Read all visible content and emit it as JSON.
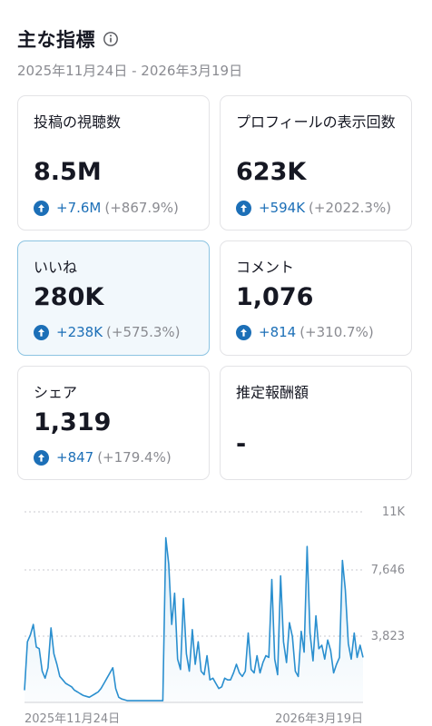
{
  "header": {
    "title": "主な指標",
    "date_range": "2025年11月24日 - 2026年3月19日"
  },
  "cards": [
    {
      "label": "投稿の視聴数",
      "value": "8.5M",
      "delta": "+7.6M",
      "pct": "(+867.9%)",
      "selected": false
    },
    {
      "label": "プロフィールの表示回数",
      "value": "623K",
      "delta": "+594K",
      "pct": "(+2022.3%)",
      "selected": false
    },
    {
      "label": "いいね",
      "value": "280K",
      "delta": "+238K",
      "pct": "(+575.3%)",
      "selected": true
    },
    {
      "label": "コメント",
      "value": "1,076",
      "delta": "+814",
      "pct": "(+310.7%)",
      "selected": false
    },
    {
      "label": "シェア",
      "value": "1,319",
      "delta": "+847",
      "pct": "(+179.4%)",
      "selected": false
    },
    {
      "label": "推定報酬額",
      "value": "-",
      "delta": "",
      "pct": "",
      "selected": false
    }
  ],
  "colors": {
    "accent": "#1c6fb7",
    "line": "#2a8fcf",
    "selected_bg": "#f2f8fc",
    "muted": "#8a8b91"
  },
  "chart_data": {
    "type": "area",
    "ylim": [
      0,
      11000
    ],
    "y_ticks": [
      "11K",
      "7,646",
      "3,823"
    ],
    "y_tick_values": [
      11000,
      7646,
      3823
    ],
    "x_labels": [
      "2025年11月24日",
      "2026年3月19日"
    ],
    "grid": true,
    "values": [
      700,
      3500,
      3900,
      4500,
      3200,
      3100,
      1800,
      1400,
      2000,
      4300,
      2800,
      2200,
      1500,
      1300,
      1100,
      1000,
      900,
      700,
      600,
      500,
      400,
      350,
      300,
      400,
      500,
      600,
      800,
      1100,
      1400,
      1700,
      2000,
      800,
      300,
      200,
      150,
      100,
      100,
      100,
      100,
      100,
      100,
      100,
      100,
      100,
      100,
      100,
      100,
      100,
      9500,
      8000,
      4500,
      6300,
      2500,
      1900,
      6000,
      2800,
      1800,
      4200,
      2200,
      3500,
      1800,
      1600,
      2700,
      1300,
      1400,
      1100,
      800,
      900,
      1400,
      1300,
      1300,
      1700,
      2200,
      1700,
      1500,
      1800,
      4000,
      1900,
      1700,
      2700,
      1700,
      2300,
      2700,
      2600,
      7100,
      2500,
      1600,
      7300,
      3500,
      2300,
      4600,
      3800,
      1800,
      1500,
      4100,
      2900,
      9000,
      4000,
      2400,
      5000,
      3100,
      3300,
      2500,
      3600,
      3000,
      1700,
      2200,
      2600,
      8200,
      6500,
      3400,
      2500,
      4000,
      2600,
      3300,
      2600
    ]
  }
}
